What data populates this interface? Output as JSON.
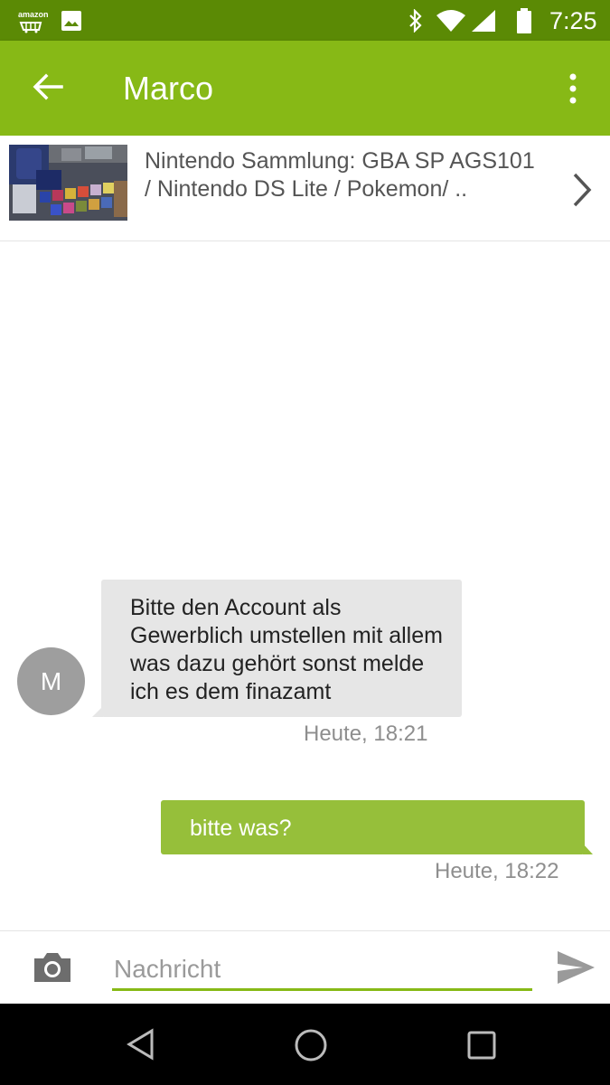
{
  "status_bar": {
    "time": "7:25",
    "notification_icons": [
      "amazon-icon",
      "image-icon"
    ],
    "amazon_label": "amazon",
    "system_icons": [
      "bluetooth-icon",
      "wifi-icon",
      "signal-icon",
      "battery-icon"
    ]
  },
  "app_bar": {
    "title": "Marco",
    "icons": [
      "back-arrow-icon",
      "more-vert-icon"
    ]
  },
  "listing": {
    "title": "Nintendo Sammlung: GBA SP AGS101 / Nintendo DS Lite / Pokemon/ .."
  },
  "messages": [
    {
      "direction": "incoming",
      "avatar_letter": "M",
      "text": "Bitte den Account als Gewerblich umstellen mit allem was dazu gehört sonst melde ich es dem finazamt",
      "timestamp": "Heute, 18:21"
    },
    {
      "direction": "outgoing",
      "text": "bitte was?",
      "timestamp": "Heute, 18:22"
    }
  ],
  "composer": {
    "placeholder": "Nachricht",
    "value": ""
  },
  "colors": {
    "status_bar": "#5b8a05",
    "app_bar": "#87b916",
    "incoming_bubble": "#e6e6e6",
    "outgoing_bubble": "#96bf3a",
    "avatar": "#9e9e9e"
  }
}
